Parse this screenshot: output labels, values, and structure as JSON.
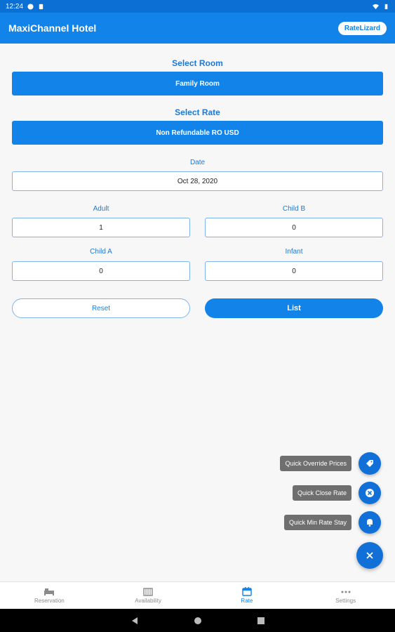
{
  "status_bar": {
    "time": "12:24"
  },
  "app_bar": {
    "title": "MaxiChannel Hotel",
    "badge": "RateLizard"
  },
  "form": {
    "select_room_label": "Select Room",
    "select_room_value": "Family Room",
    "select_rate_label": "Select Rate",
    "select_rate_value": "Non Refundable RO USD",
    "date_label": "Date",
    "date_value": "Oct 28, 2020",
    "adult_label": "Adult",
    "adult_value": "1",
    "child_b_label": "Child B",
    "child_b_value": "0",
    "child_a_label": "Child A",
    "child_a_value": "0",
    "infant_label": "Infant",
    "infant_value": "0",
    "reset_label": "Reset",
    "list_label": "List"
  },
  "fab_menu": {
    "items": [
      {
        "label": "Quick Override Prices",
        "icon": "tag-icon"
      },
      {
        "label": "Quick Close Rate",
        "icon": "close-circle-icon"
      },
      {
        "label": "Quick Min Rate Stay",
        "icon": "bell-icon"
      }
    ],
    "main_icon": "close-icon"
  },
  "bottom_nav": {
    "items": [
      {
        "label": "Reservation",
        "icon": "bed-icon"
      },
      {
        "label": "Availability",
        "icon": "availability-icon"
      },
      {
        "label": "Rate",
        "icon": "calendar-icon"
      },
      {
        "label": "Settings",
        "icon": "more-icon"
      }
    ],
    "active": "Rate"
  },
  "colors": {
    "primary": "#1283e8",
    "fab": "#1070d8",
    "label_gray": "#6f6f6f"
  }
}
